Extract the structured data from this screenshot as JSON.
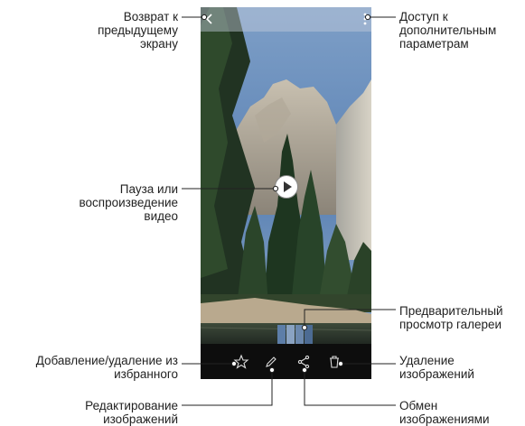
{
  "callouts": {
    "back": "Возврат к\nпредыдущему\nэкрану",
    "more": "Доступ к\nдополнительным\nпараметрам",
    "play": "Пауза или\nвоспроизведение\nвидео",
    "preview": "Предварительный\nпросмотр галереи",
    "favorite": "Добавление/удаление из\nизбранного",
    "delete": "Удаление\nизображений",
    "edit": "Редактирование\nизображений",
    "share": "Обмен\nизображениями"
  },
  "icons": {
    "back": "back-arrow-icon",
    "more": "more-vert-icon",
    "play": "play-icon",
    "favorite": "star-icon",
    "edit": "pencil-icon",
    "share": "share-icon",
    "delete": "trash-icon"
  },
  "colors": {
    "screen_sky": "#5c84b5",
    "bottom_bar": "#0d0d0d",
    "callout_line": "#222222"
  }
}
